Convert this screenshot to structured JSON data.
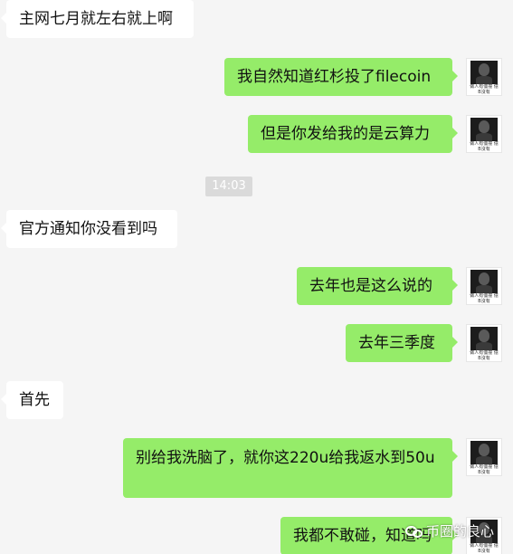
{
  "chat": {
    "messages": [
      {
        "id": "m0",
        "dir": "in",
        "text": "主网七月就左右就上啊"
      },
      {
        "id": "m1",
        "dir": "out",
        "text": "我自然知道红杉投了filecoin"
      },
      {
        "id": "m2",
        "dir": "out",
        "text": "但是你发给我的是云算力"
      },
      {
        "id": "m3",
        "dir": "in",
        "text": "官方通知你没看到吗"
      },
      {
        "id": "m4",
        "dir": "out",
        "text": "去年也是这么说的"
      },
      {
        "id": "m5",
        "dir": "out",
        "text": "去年三季度"
      },
      {
        "id": "m6",
        "dir": "in",
        "text": "首先"
      },
      {
        "id": "m7",
        "dir": "out",
        "text": "别给我洗脑了，就你这220u给我返水到50u"
      },
      {
        "id": "m8",
        "dir": "out",
        "text": "我都不敢碰，知道吗"
      }
    ],
    "timestamp": "14:03",
    "avatar_caption": "做人有僵撞 億B沒有",
    "watermark": "币圈的良心"
  },
  "colors": {
    "background": "#f5f5f5",
    "outgoing_bubble": "#95ec69",
    "incoming_bubble": "#ffffff",
    "timestamp_bg": "#dadada"
  },
  "icons": {
    "avatar": "portrait-avatar-icon",
    "watermark": "wechat-logo-icon"
  }
}
